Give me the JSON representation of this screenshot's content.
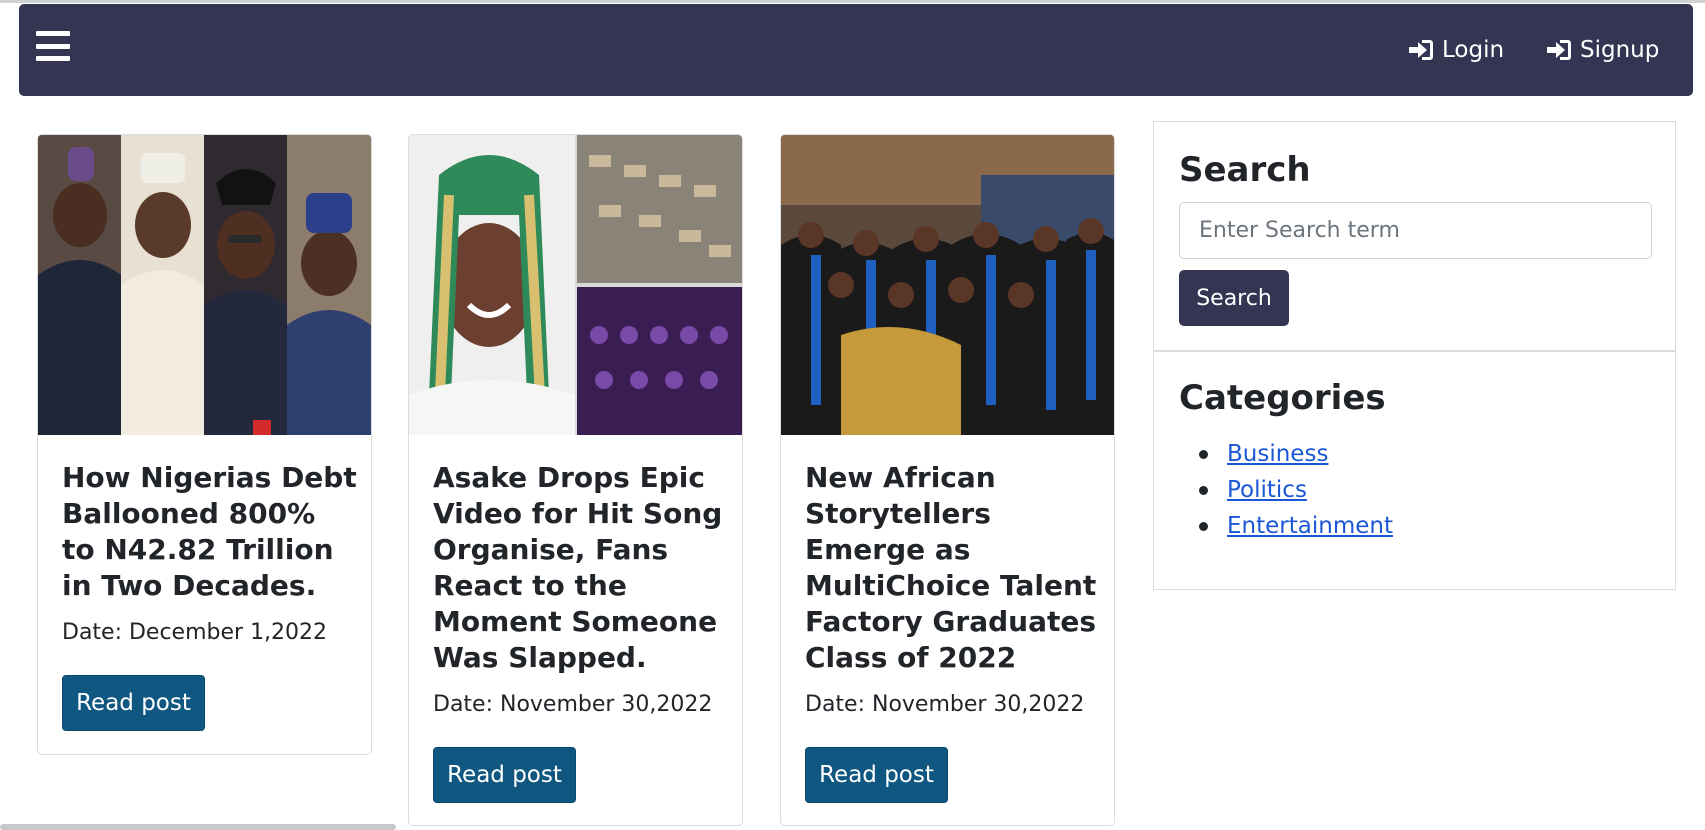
{
  "navbar": {
    "menu_icon": "hamburger-menu-icon",
    "login_label": "Login",
    "signup_label": "Signup",
    "login_icon": "sign-in-icon",
    "signup_icon": "sign-in-icon",
    "background": "#343553"
  },
  "posts": [
    {
      "title": "How Nigerias Debt Ballooned 800% to N42.82 Trillion in Two Decades.",
      "date": "Date: December 1,2022",
      "button": "Read post"
    },
    {
      "title": "Asake Drops Epic Video for Hit Song Organise, Fans React to the Moment Someone Was Slapped.",
      "date": "Date: November 30,2022",
      "button": "Read post"
    },
    {
      "title": "New African Storytellers Emerge as MultiChoice Talent Factory Graduates Class of 2022",
      "date": "Date: November 30,2022",
      "button": "Read post"
    }
  ],
  "sidebar": {
    "search_heading": "Search",
    "search_placeholder": "Enter Search term",
    "search_button": "Search",
    "categories_heading": "Categories",
    "categories": [
      "Business",
      "Politics",
      "Entertainment"
    ]
  },
  "colors": {
    "primary_button": "#0f5780",
    "dark": "#343553",
    "link": "#1a56d6"
  }
}
